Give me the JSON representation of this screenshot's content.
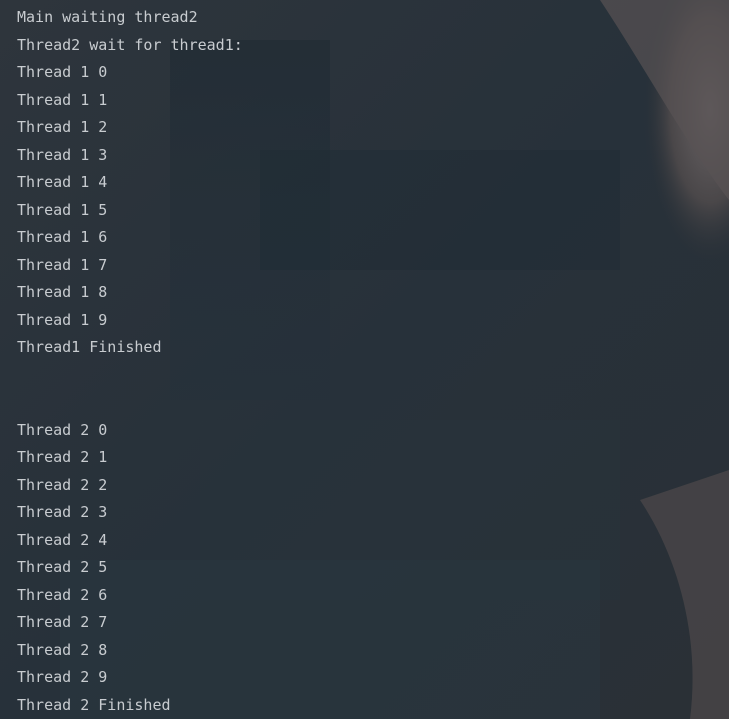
{
  "console": {
    "lines": [
      "Main waiting thread2",
      "Thread2 wait for thread1:",
      "Thread 1 0",
      "Thread 1 1",
      "Thread 1 2",
      "Thread 1 3",
      "Thread 1 4",
      "Thread 1 5",
      "Thread 1 6",
      "Thread 1 7",
      "Thread 1 8",
      "Thread 1 9",
      "Thread1 Finished",
      "",
      "",
      "Thread 2 0",
      "Thread 2 1",
      "Thread 2 2",
      "Thread 2 3",
      "Thread 2 4",
      "Thread 2 5",
      "Thread 2 6",
      "Thread 2 7",
      "Thread 2 8",
      "Thread 2 9",
      "Thread 2 Finished"
    ]
  },
  "colors": {
    "text": "#c8ccd0",
    "background": "#2a3138"
  }
}
